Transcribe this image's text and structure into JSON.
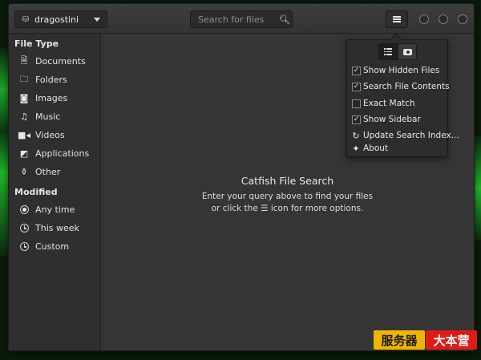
{
  "places": {
    "selected": "dragostini"
  },
  "search": {
    "placeholder": "Search for files"
  },
  "sidebar": {
    "file_type_header": "File Type",
    "file_types": [
      "Documents",
      "Folders",
      "Images",
      "Music",
      "Videos",
      "Applications",
      "Other"
    ],
    "modified_header": "Modified",
    "modified": [
      "Any time",
      "This week",
      "Custom"
    ],
    "modified_selected": "Any time"
  },
  "main": {
    "title": "Catfish File Search",
    "line1": "Enter your query above to find your files",
    "line2": "or click the ☰ icon for more options."
  },
  "menu": {
    "show_hidden": "Show Hidden Files",
    "search_contents": "Search File Contents",
    "exact_match": "Exact Match",
    "show_sidebar": "Show Sidebar",
    "update_index": "Update Search Index...",
    "about": "About",
    "states": {
      "show_hidden": true,
      "search_contents": true,
      "exact_match": false,
      "show_sidebar": true
    }
  },
  "watermark": {
    "part1": "服务器",
    "part2": "大本营"
  },
  "colors": {
    "window_bg": "#353535",
    "sidebar_bg": "#2f2f2f",
    "desktop_glow": "#1fb52a",
    "watermark_yellow": "#f0b400",
    "watermark_red": "#e01b14"
  },
  "icons": [
    "drive-icon",
    "search-icon",
    "menu-icon",
    "document-icon",
    "folder-icon",
    "image-icon",
    "music-icon",
    "video-icon",
    "applications-icon",
    "other-icon",
    "radio-icon",
    "clock-icon",
    "list-view-icon",
    "thumbnail-view-icon",
    "refresh-icon",
    "about-icon"
  ]
}
